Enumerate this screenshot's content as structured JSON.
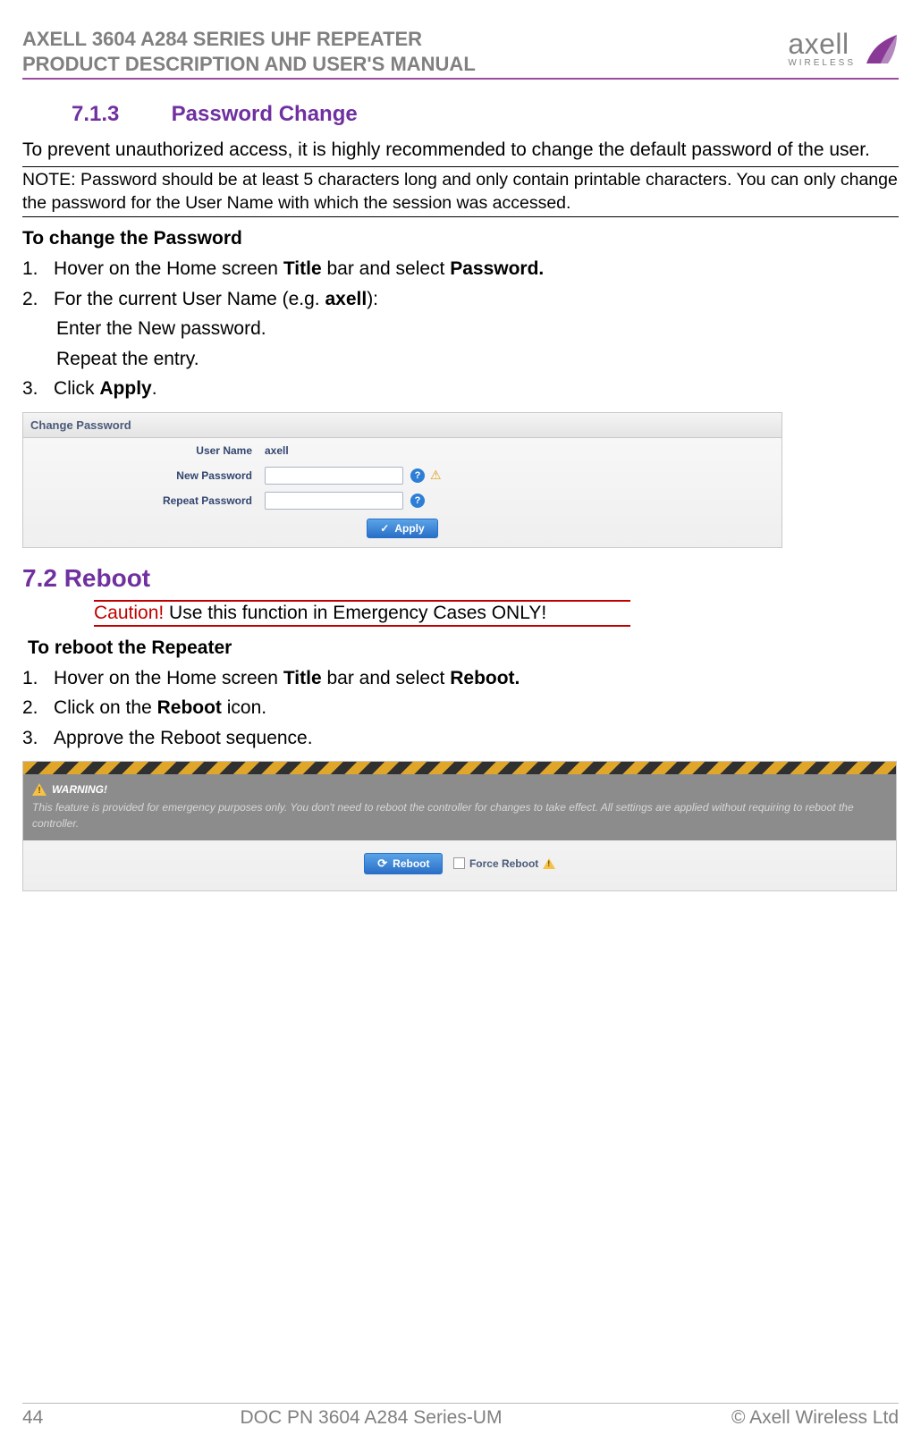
{
  "header": {
    "line1": "AXELL 3604 A284 SERIES UHF REPEATER",
    "line2": "PRODUCT DESCRIPTION AND USER'S MANUAL",
    "logo_text": "axell",
    "logo_sub": "WIRELESS"
  },
  "s713": {
    "num": "7.1.3",
    "title": "Password Change",
    "intro": "To prevent unauthorized access, it is highly recommended to change the default password of the user.",
    "note": "NOTE: Password should be at least 5 characters long and only contain printable characters. You can only change the password for the User Name with which the session was accessed.",
    "subhead": "To change the Password",
    "item1_pre": "Hover on the Home screen ",
    "item1_b1": "Title",
    "item1_mid": " bar and select ",
    "item1_b2": "Password.",
    "item2_pre": "For the current User Name (e.g. ",
    "item2_b": "axell",
    "item2_post": "):",
    "item2_sub1": "Enter the New password.",
    "item2_sub2": "Repeat the entry.",
    "item3_pre": "Click ",
    "item3_b": "Apply",
    "item3_post": "."
  },
  "screenshot1": {
    "panel_title": "Change Password",
    "label_user": "User Name",
    "value_user": "axell",
    "label_new": "New Password",
    "label_repeat": "Repeat Password",
    "apply_btn": "Apply"
  },
  "s72": {
    "heading": "7.2  Reboot",
    "caution_red": "Caution!",
    "caution_rest": " Use this function in Emergency Cases ONLY!",
    "subhead": "To reboot the Repeater",
    "item1_pre": "Hover on the Home screen ",
    "item1_b1": "Title",
    "item1_mid": " bar and select ",
    "item1_b2": "Reboot.",
    "item2_pre": "Click on the ",
    "item2_b": "Reboot",
    "item2_post": " icon.",
    "item3": "Approve the Reboot sequence."
  },
  "screenshot2": {
    "warn_title": "WARNING!",
    "warn_text": "This feature is provided for emergency purposes only. You don't need to reboot the controller for changes to take effect. All settings are applied without requiring to reboot the controller.",
    "reboot_btn": "Reboot",
    "force_label": "Force Reboot"
  },
  "footer": {
    "page": "44",
    "center": "DOC PN 3604 A284 Series-UM",
    "right": "© Axell Wireless Ltd"
  }
}
